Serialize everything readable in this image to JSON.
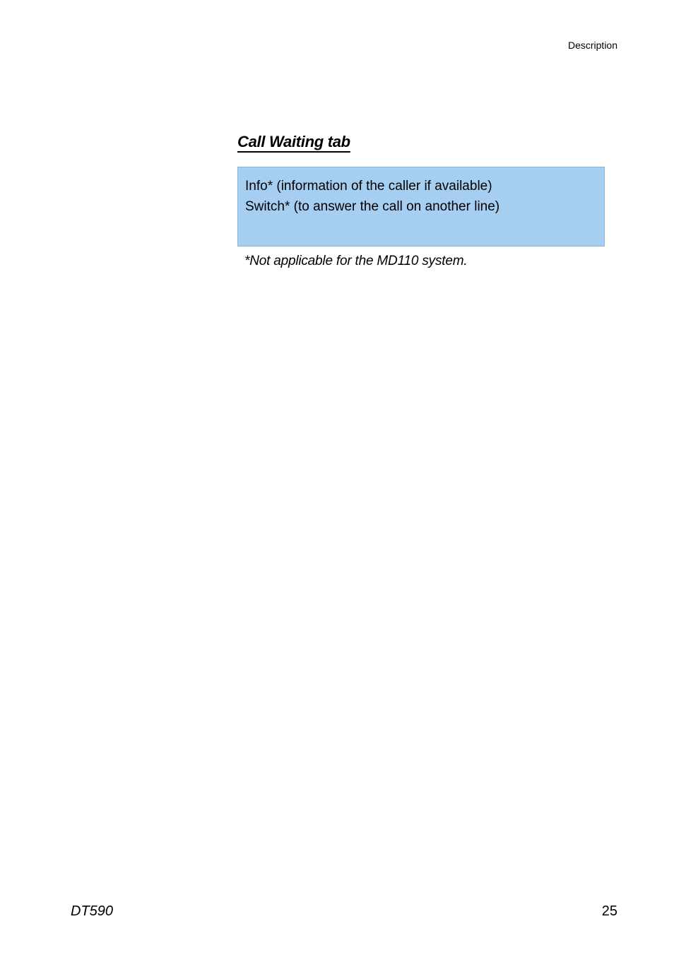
{
  "header": {
    "label": "Description"
  },
  "section": {
    "heading": "Call Waiting tab",
    "box": {
      "line1": "Info* (information of the caller if available)",
      "line2": "Switch* (to answer the call on another line)"
    },
    "footnote": "*Not applicable for the MD110 system."
  },
  "footer": {
    "left": "DT590",
    "right": "25"
  }
}
